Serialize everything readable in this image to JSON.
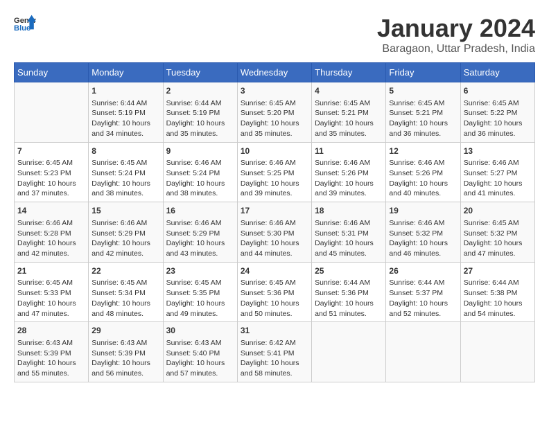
{
  "logo": {
    "general": "General",
    "blue": "Blue"
  },
  "title": "January 2024",
  "location": "Baragaon, Uttar Pradesh, India",
  "days_header": [
    "Sunday",
    "Monday",
    "Tuesday",
    "Wednesday",
    "Thursday",
    "Friday",
    "Saturday"
  ],
  "weeks": [
    [
      {
        "day": "",
        "info": ""
      },
      {
        "day": "1",
        "info": "Sunrise: 6:44 AM\nSunset: 5:19 PM\nDaylight: 10 hours\nand 34 minutes."
      },
      {
        "day": "2",
        "info": "Sunrise: 6:44 AM\nSunset: 5:19 PM\nDaylight: 10 hours\nand 35 minutes."
      },
      {
        "day": "3",
        "info": "Sunrise: 6:45 AM\nSunset: 5:20 PM\nDaylight: 10 hours\nand 35 minutes."
      },
      {
        "day": "4",
        "info": "Sunrise: 6:45 AM\nSunset: 5:21 PM\nDaylight: 10 hours\nand 35 minutes."
      },
      {
        "day": "5",
        "info": "Sunrise: 6:45 AM\nSunset: 5:21 PM\nDaylight: 10 hours\nand 36 minutes."
      },
      {
        "day": "6",
        "info": "Sunrise: 6:45 AM\nSunset: 5:22 PM\nDaylight: 10 hours\nand 36 minutes."
      }
    ],
    [
      {
        "day": "7",
        "info": "Sunrise: 6:45 AM\nSunset: 5:23 PM\nDaylight: 10 hours\nand 37 minutes."
      },
      {
        "day": "8",
        "info": "Sunrise: 6:45 AM\nSunset: 5:24 PM\nDaylight: 10 hours\nand 38 minutes."
      },
      {
        "day": "9",
        "info": "Sunrise: 6:46 AM\nSunset: 5:24 PM\nDaylight: 10 hours\nand 38 minutes."
      },
      {
        "day": "10",
        "info": "Sunrise: 6:46 AM\nSunset: 5:25 PM\nDaylight: 10 hours\nand 39 minutes."
      },
      {
        "day": "11",
        "info": "Sunrise: 6:46 AM\nSunset: 5:26 PM\nDaylight: 10 hours\nand 39 minutes."
      },
      {
        "day": "12",
        "info": "Sunrise: 6:46 AM\nSunset: 5:26 PM\nDaylight: 10 hours\nand 40 minutes."
      },
      {
        "day": "13",
        "info": "Sunrise: 6:46 AM\nSunset: 5:27 PM\nDaylight: 10 hours\nand 41 minutes."
      }
    ],
    [
      {
        "day": "14",
        "info": "Sunrise: 6:46 AM\nSunset: 5:28 PM\nDaylight: 10 hours\nand 42 minutes."
      },
      {
        "day": "15",
        "info": "Sunrise: 6:46 AM\nSunset: 5:29 PM\nDaylight: 10 hours\nand 42 minutes."
      },
      {
        "day": "16",
        "info": "Sunrise: 6:46 AM\nSunset: 5:29 PM\nDaylight: 10 hours\nand 43 minutes."
      },
      {
        "day": "17",
        "info": "Sunrise: 6:46 AM\nSunset: 5:30 PM\nDaylight: 10 hours\nand 44 minutes."
      },
      {
        "day": "18",
        "info": "Sunrise: 6:46 AM\nSunset: 5:31 PM\nDaylight: 10 hours\nand 45 minutes."
      },
      {
        "day": "19",
        "info": "Sunrise: 6:46 AM\nSunset: 5:32 PM\nDaylight: 10 hours\nand 46 minutes."
      },
      {
        "day": "20",
        "info": "Sunrise: 6:45 AM\nSunset: 5:32 PM\nDaylight: 10 hours\nand 47 minutes."
      }
    ],
    [
      {
        "day": "21",
        "info": "Sunrise: 6:45 AM\nSunset: 5:33 PM\nDaylight: 10 hours\nand 47 minutes."
      },
      {
        "day": "22",
        "info": "Sunrise: 6:45 AM\nSunset: 5:34 PM\nDaylight: 10 hours\nand 48 minutes."
      },
      {
        "day": "23",
        "info": "Sunrise: 6:45 AM\nSunset: 5:35 PM\nDaylight: 10 hours\nand 49 minutes."
      },
      {
        "day": "24",
        "info": "Sunrise: 6:45 AM\nSunset: 5:36 PM\nDaylight: 10 hours\nand 50 minutes."
      },
      {
        "day": "25",
        "info": "Sunrise: 6:44 AM\nSunset: 5:36 PM\nDaylight: 10 hours\nand 51 minutes."
      },
      {
        "day": "26",
        "info": "Sunrise: 6:44 AM\nSunset: 5:37 PM\nDaylight: 10 hours\nand 52 minutes."
      },
      {
        "day": "27",
        "info": "Sunrise: 6:44 AM\nSunset: 5:38 PM\nDaylight: 10 hours\nand 54 minutes."
      }
    ],
    [
      {
        "day": "28",
        "info": "Sunrise: 6:43 AM\nSunset: 5:39 PM\nDaylight: 10 hours\nand 55 minutes."
      },
      {
        "day": "29",
        "info": "Sunrise: 6:43 AM\nSunset: 5:39 PM\nDaylight: 10 hours\nand 56 minutes."
      },
      {
        "day": "30",
        "info": "Sunrise: 6:43 AM\nSunset: 5:40 PM\nDaylight: 10 hours\nand 57 minutes."
      },
      {
        "day": "31",
        "info": "Sunrise: 6:42 AM\nSunset: 5:41 PM\nDaylight: 10 hours\nand 58 minutes."
      },
      {
        "day": "",
        "info": ""
      },
      {
        "day": "",
        "info": ""
      },
      {
        "day": "",
        "info": ""
      }
    ]
  ]
}
